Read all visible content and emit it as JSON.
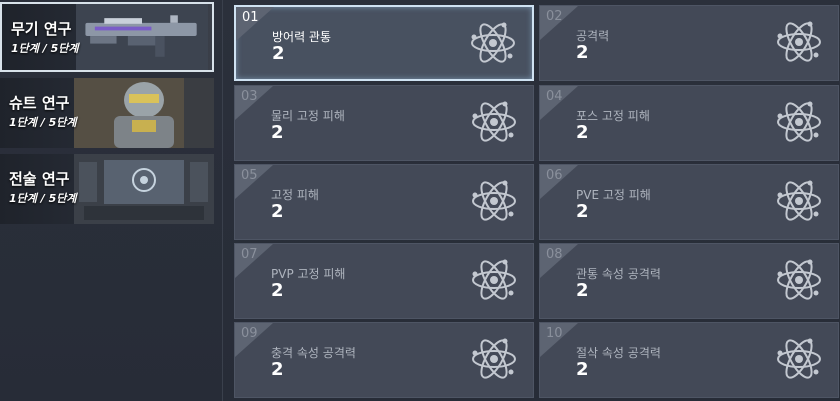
{
  "categories": [
    {
      "title": "무기 연구",
      "progress": "1단계 / 5단계",
      "icon": "rifle-art",
      "active": true
    },
    {
      "title": "슈트 연구",
      "progress": "1단계 / 5단계",
      "icon": "armor-suit-art",
      "active": false
    },
    {
      "title": "전술 연구",
      "progress": "1단계 / 5단계",
      "icon": "lab-console-art",
      "active": false
    }
  ],
  "cards": [
    {
      "num": "01",
      "label": "방어력 관통",
      "value": "2",
      "selected": true
    },
    {
      "num": "02",
      "label": "공격력",
      "value": "2"
    },
    {
      "num": "03",
      "label": "물리 고정 피해",
      "value": "2"
    },
    {
      "num": "04",
      "label": "포스 고정 피해",
      "value": "2"
    },
    {
      "num": "05",
      "label": "고정 피해",
      "value": "2"
    },
    {
      "num": "06",
      "label": "PVE 고정 피해",
      "value": "2"
    },
    {
      "num": "07",
      "label": "PVP 고정 피해",
      "value": "2"
    },
    {
      "num": "08",
      "label": "관통 속성 공격력",
      "value": "2"
    },
    {
      "num": "09",
      "label": "충격 속성 공격력",
      "value": "2"
    },
    {
      "num": "10",
      "label": "절삭 속성 공격력",
      "value": "2"
    }
  ],
  "colors": {
    "selected_border": "#cfe2f2",
    "card_bg": "#434957",
    "panel_bg": "#2b303b"
  }
}
